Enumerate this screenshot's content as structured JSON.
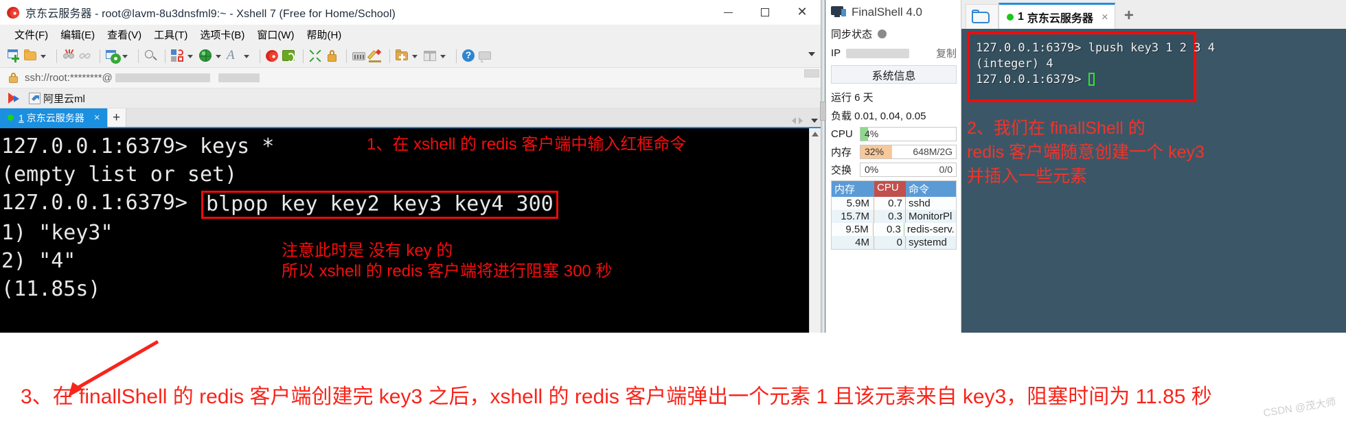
{
  "xshell": {
    "title": "京东云服务器 - root@lavm-8u3dnsfml9:~ - Xshell 7 (Free for Home/School)",
    "app_icon": "xshell-logo-icon",
    "window_buttons": {
      "minimize": "minimize-icon",
      "maximize": "maximize-icon",
      "close": "close-icon"
    },
    "menu": [
      {
        "label": "文件(F)",
        "key": "F"
      },
      {
        "label": "编辑(E)",
        "key": "E"
      },
      {
        "label": "查看(V)",
        "key": "V"
      },
      {
        "label": "工具(T)",
        "key": "T"
      },
      {
        "label": "选项卡(B)",
        "key": "B"
      },
      {
        "label": "窗口(W)",
        "key": "W"
      },
      {
        "label": "帮助(H)",
        "key": "H"
      }
    ],
    "toolbar": [
      {
        "name": "new-session-icon",
        "dropdown": false
      },
      {
        "name": "open-folder-icon",
        "dropdown": true
      },
      {
        "name": "disconnect-icon",
        "dropdown": false
      },
      {
        "name": "reconnect-icon",
        "dropdown": false
      },
      {
        "name": "session-properties-icon",
        "dropdown": true
      },
      {
        "name": "find-icon",
        "dropdown": false
      },
      {
        "name": "file-transfer-icon",
        "dropdown": true
      },
      {
        "name": "globe-icon",
        "dropdown": true
      },
      {
        "name": "font-icon",
        "dropdown": true
      },
      {
        "name": "xshell-icon",
        "dropdown": false
      },
      {
        "name": "xftp-icon",
        "dropdown": false
      },
      {
        "name": "fullscreen-icon",
        "dropdown": false
      },
      {
        "name": "lock-icon",
        "dropdown": false
      },
      {
        "name": "keyboard-icon",
        "dropdown": false
      },
      {
        "name": "highlight-pen-icon",
        "dropdown": false
      },
      {
        "name": "add-folder-icon",
        "dropdown": true
      },
      {
        "name": "layout-icon",
        "dropdown": true
      },
      {
        "name": "help-icon",
        "dropdown": false
      },
      {
        "name": "chat-icon",
        "dropdown": false
      }
    ],
    "address_bar": {
      "lock_icon": "lock-icon",
      "value": "ssh://root:********@",
      "redacted": true
    },
    "host_row": {
      "flag_icon": "bookmark-flag-icon",
      "chip_icon": "shortcut-icon",
      "label": "阿里云ml"
    },
    "tab": {
      "status": "connected",
      "number": "1",
      "label": "京东云服务器",
      "close": "×",
      "new_tab": "+"
    },
    "terminal": {
      "lines": [
        {
          "type": "plain",
          "text": "127.0.0.1:6379> keys *"
        },
        {
          "type": "plain",
          "text": "(empty list or set)"
        },
        {
          "type": "prompt_boxed",
          "prompt": "127.0.0.1:6379> ",
          "command": "blpop key key2 key3 key4 300"
        },
        {
          "type": "plain",
          "text": "1) \"key3\""
        },
        {
          "type": "plain",
          "text": "2) \"4\""
        },
        {
          "type": "plain",
          "text": "(11.85s)"
        }
      ],
      "notes": [
        "1、在 xshell 的 redis 客户端中输入红框命令",
        "注意此时是 没有 key 的\n所以 xshell 的 redis 客户端将进行阻塞 300 秒"
      ],
      "note2_line1": "注意此时是 没有 key 的",
      "note2_line2": "所以 xshell 的 redis 客户端将进行阻塞 300 秒"
    }
  },
  "finalshell": {
    "brand": "FinalShell 4.0",
    "brand_icon": "monitor-icon",
    "sync": {
      "label": "同步状态",
      "status_icon": "status-dot-icon"
    },
    "ip": {
      "label": "IP",
      "value_redacted": true,
      "copy_label": "复制"
    },
    "sysinfo_button": "系统信息",
    "uptime": "运行 6 天",
    "load": "负载 0.01, 0.04, 0.05",
    "meters": [
      {
        "label": "CPU",
        "percent": "4%",
        "fill": 4,
        "right": "",
        "color": "#8ed88e"
      },
      {
        "label": "内存",
        "percent": "32%",
        "fill": 32,
        "right": "648M/2G",
        "color": "#f7c89a"
      },
      {
        "label": "交换",
        "percent": "0%",
        "fill": 0,
        "right": "0/0",
        "color": "#cfcfcf"
      }
    ],
    "process_table": {
      "headers": [
        "内存",
        "CPU",
        "命令"
      ],
      "rows": [
        [
          "5.9M",
          "0.7",
          "sshd"
        ],
        [
          "15.7M",
          "0.3",
          "MonitorPl"
        ],
        [
          "9.5M",
          "0.3",
          "redis-serv."
        ],
        [
          "4M",
          "0",
          "systemd"
        ]
      ]
    },
    "tab": {
      "folder_icon": "open-folder-icon",
      "status": "connected",
      "number": "1",
      "label": "京东云服务器",
      "close": "×",
      "new_tab": "+"
    },
    "terminal": {
      "lines": [
        "127.0.0.1:6379> lpush key3 1 2 3 4",
        "(integer) 4",
        "127.0.0.1:6379> "
      ],
      "cursor": true,
      "note_lines": [
        "2、我们在 finallShell 的",
        "redis 客户端随意创建一个 key3",
        "并插入一些元素"
      ]
    }
  },
  "bottom": {
    "arrow": "red-arrow-annotation",
    "caption": "3、在 finallShell 的 redis 客户端创建完 key3 之后，xshell 的 redis 客户端弹出一个元素 1 且该元素来自 key3，阻塞时间为 11.85 秒",
    "watermark": "CSDN @茂大师"
  },
  "colors": {
    "annotation_red": "#f60d0d",
    "xshell_tab_blue": "#1b8fe0",
    "finalshell_terminal_bg": "#3b5767",
    "terminal_bg": "#000000",
    "status_green": "#19d419"
  }
}
